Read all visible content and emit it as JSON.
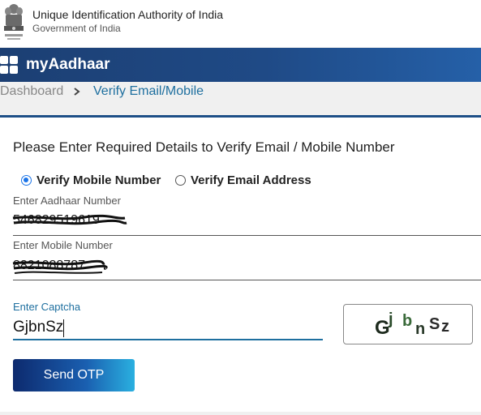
{
  "header": {
    "org_name": "Unique Identification Authority of India",
    "org_sub": "Government of India",
    "emblem_icon": "national-emblem-icon"
  },
  "banner": {
    "brand": "myAadhaar",
    "icon": "app-grid-icon",
    "color_start": "#1c3f73",
    "color_end": "#2560a8"
  },
  "breadcrumb": {
    "home": "Dashboard",
    "separator": ">",
    "current": "Verify Email/Mobile"
  },
  "form": {
    "heading": "Please Enter Required Details to Verify Email / Mobile Number",
    "options": [
      {
        "label": "Verify Mobile Number",
        "selected": true
      },
      {
        "label": "Verify Email Address",
        "selected": false
      }
    ],
    "aadhaar_label": "Enter Aadhaar Number",
    "aadhaar_value": "546829519619",
    "mobile_label": "Enter Mobile Number",
    "mobile_value": "8821088787",
    "captcha_label": "Enter Captcha",
    "captcha_value": "GjbnSz",
    "captcha_image_text": "GjbnSz",
    "send_button": "Send OTP"
  },
  "colors": {
    "accent": "#1e6f9f",
    "radio": "#1a73e8"
  }
}
